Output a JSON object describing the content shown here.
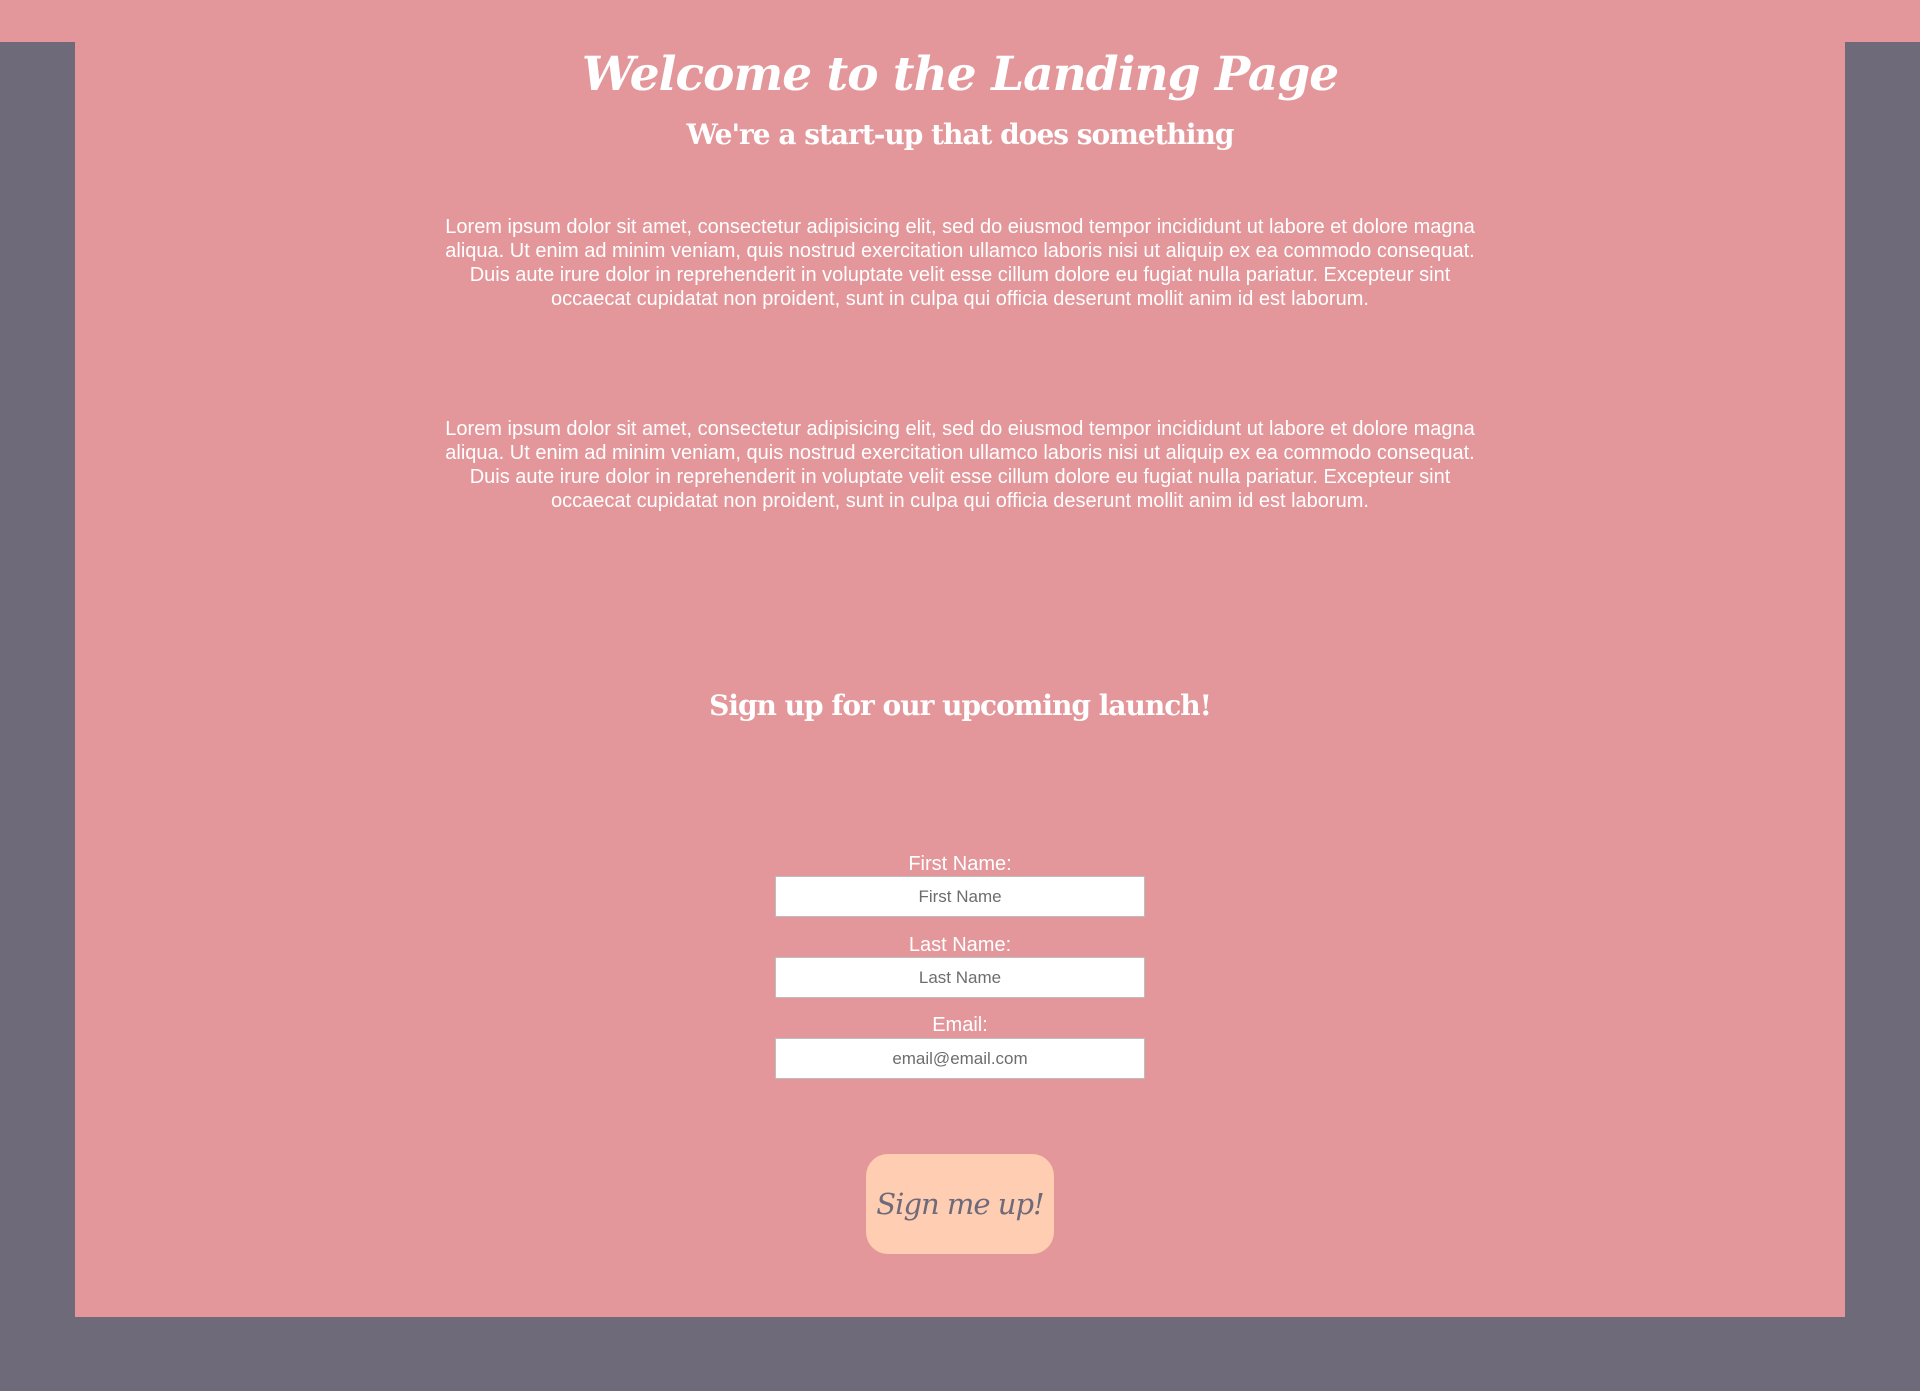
{
  "colors": {
    "background": "#6e6a79",
    "card": "#e3979b",
    "text": "#ffffff",
    "button": "#ffcdb2",
    "button_text": "#6e6a79"
  },
  "header": {
    "title": "Welcome to the Landing Page",
    "subtitle": "We're a start-up that does something"
  },
  "content": {
    "paragraphs": [
      "Lorem ipsum dolor sit amet, consectetur adipisicing elit, sed do eiusmod tempor incididunt ut labore et dolore magna aliqua. Ut enim ad minim veniam, quis nostrud exercitation ullamco laboris nisi ut aliquip ex ea commodo consequat. Duis aute irure dolor in reprehenderit in voluptate velit esse cillum dolore eu fugiat nulla pariatur. Excepteur sint occaecat cupidatat non proident, sunt in culpa qui officia deserunt mollit anim id est laborum.",
      "Lorem ipsum dolor sit amet, consectetur adipisicing elit, sed do eiusmod tempor incididunt ut labore et dolore magna aliqua. Ut enim ad minim veniam, quis nostrud exercitation ullamco laboris nisi ut aliquip ex ea commodo consequat. Duis aute irure dolor in reprehenderit in voluptate velit esse cillum dolore eu fugiat nulla pariatur. Excepteur sint occaecat cupidatat non proident, sunt in culpa qui officia deserunt mollit anim id est laborum."
    ]
  },
  "signup": {
    "heading": "Sign up for our upcoming launch!",
    "fields": [
      {
        "label": "First Name:",
        "value": "",
        "placeholder": "First Name"
      },
      {
        "label": "Last Name:",
        "value": "",
        "placeholder": "Last Name"
      },
      {
        "label": "Email:",
        "value": "",
        "placeholder": "email@email.com"
      }
    ],
    "button_label": "Sign me up!"
  }
}
